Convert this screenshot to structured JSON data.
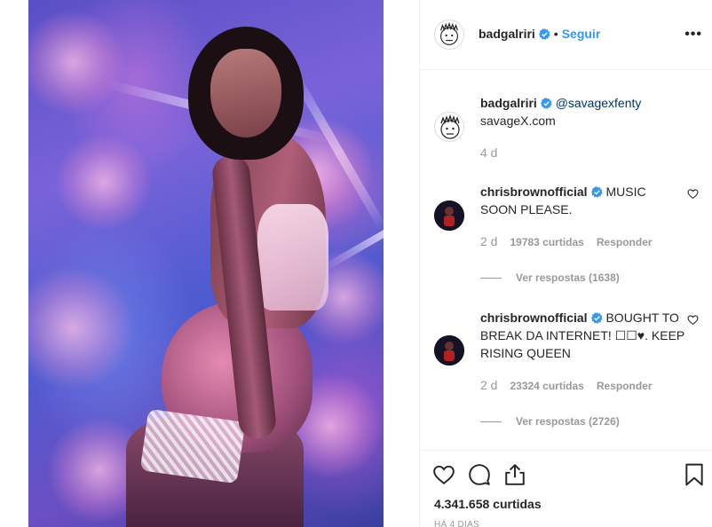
{
  "post": {
    "image_alt": "photo"
  },
  "header": {
    "username": "badgalriri",
    "separator": "•",
    "follow_label": "Seguir",
    "more_label": "•••"
  },
  "caption": {
    "username": "badgalriri",
    "mention": "@savagexfenty",
    "text": "savageX.com",
    "age": "4 d"
  },
  "comments": [
    {
      "username": "chrisbrownofficial",
      "text": "MUSIC SOON PLEASE.",
      "age": "2 d",
      "likes": "19783 curtidas",
      "reply_label": "Responder",
      "view_replies": "Ver respostas (1638)"
    },
    {
      "username": "chrisbrownofficial",
      "text": "BOUGHT TO BREAK DA INTERNET! ☐☐♥. KEEP RISING QUEEN",
      "age": "2 d",
      "likes": "23324 curtidas",
      "reply_label": "Responder",
      "view_replies": "Ver respostas (2726)"
    }
  ],
  "footer": {
    "likes": "4.341.658 curtidas",
    "time_ago": "HÁ 4 DIAS"
  },
  "icons": {
    "like": "heart-icon",
    "comment": "comment-icon",
    "share": "share-icon",
    "save": "bookmark-icon",
    "verified": "verified-badge-icon"
  },
  "colors": {
    "link_blue": "#3897f0",
    "mention_blue": "#003569",
    "muted": "#999999",
    "text": "#262626"
  }
}
